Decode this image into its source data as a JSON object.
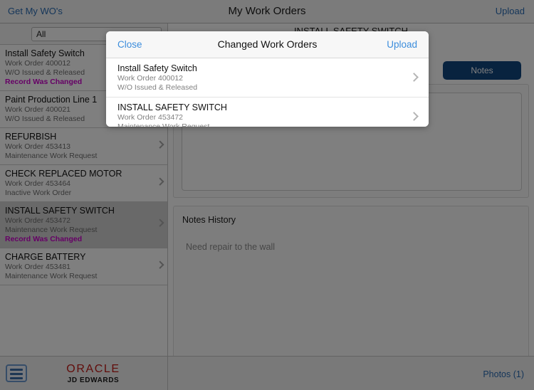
{
  "navbar": {
    "left_button": "Get My WO's",
    "title": "My Work Orders",
    "right_button": "Upload"
  },
  "sidebar": {
    "search": {
      "value": "All",
      "placeholder": "All"
    },
    "work_orders": [
      {
        "title": "Install Safety Switch",
        "order": "Work Order 400012",
        "status": "W/O Issued & Released",
        "changed": "Record Was Changed",
        "selected": false,
        "chevron": false
      },
      {
        "title": "Paint Production Line 1",
        "order": "Work Order 400021",
        "status": "W/O Issued & Released",
        "changed": "",
        "selected": false,
        "chevron": false
      },
      {
        "title": "REFURBISH",
        "order": "Work Order 453413",
        "status": "Maintenance Work Request",
        "changed": "",
        "selected": false,
        "chevron": true
      },
      {
        "title": "CHECK REPLACED MOTOR",
        "order": "Work Order 453464",
        "status": "Inactive Work Order",
        "changed": "",
        "selected": false,
        "chevron": true
      },
      {
        "title": "INSTALL SAFETY SWITCH",
        "order": "Work Order 453472",
        "status": "Maintenance Work Request",
        "changed": "Record Was Changed",
        "selected": true,
        "chevron": true
      },
      {
        "title": "CHARGE BATTERY",
        "order": "Work Order 453481",
        "status": "Maintenance Work Request",
        "changed": "",
        "selected": false,
        "chevron": true
      }
    ],
    "footer": {
      "menu_icon": "hamburger-menu-icon",
      "brand_primary": "ORACLE",
      "brand_secondary": "JD EDWARDS"
    }
  },
  "detail": {
    "title": "INSTALL SAFETY SWITCH",
    "segment_button": "Notes",
    "notes_value": "",
    "history_label": "Notes History",
    "history_text": "Need repair to the wall",
    "footer_link": "Photos (1)"
  },
  "modal": {
    "close_label": "Close",
    "title": "Changed Work Orders",
    "upload_label": "Upload",
    "rows": [
      {
        "title": "Install Safety Switch",
        "order": "Work Order 400012",
        "status": "W/O Issued & Released"
      },
      {
        "title": "INSTALL SAFETY SWITCH",
        "order": "Work Order 453472",
        "status": "Maintenance Work Request"
      }
    ]
  },
  "colors": {
    "link_blue": "#2b6cb4",
    "modal_link_blue": "#3c8ddc",
    "changed_magenta": "#cc00cc",
    "segment_blue": "#10467f",
    "oracle_red": "#c31a16"
  }
}
